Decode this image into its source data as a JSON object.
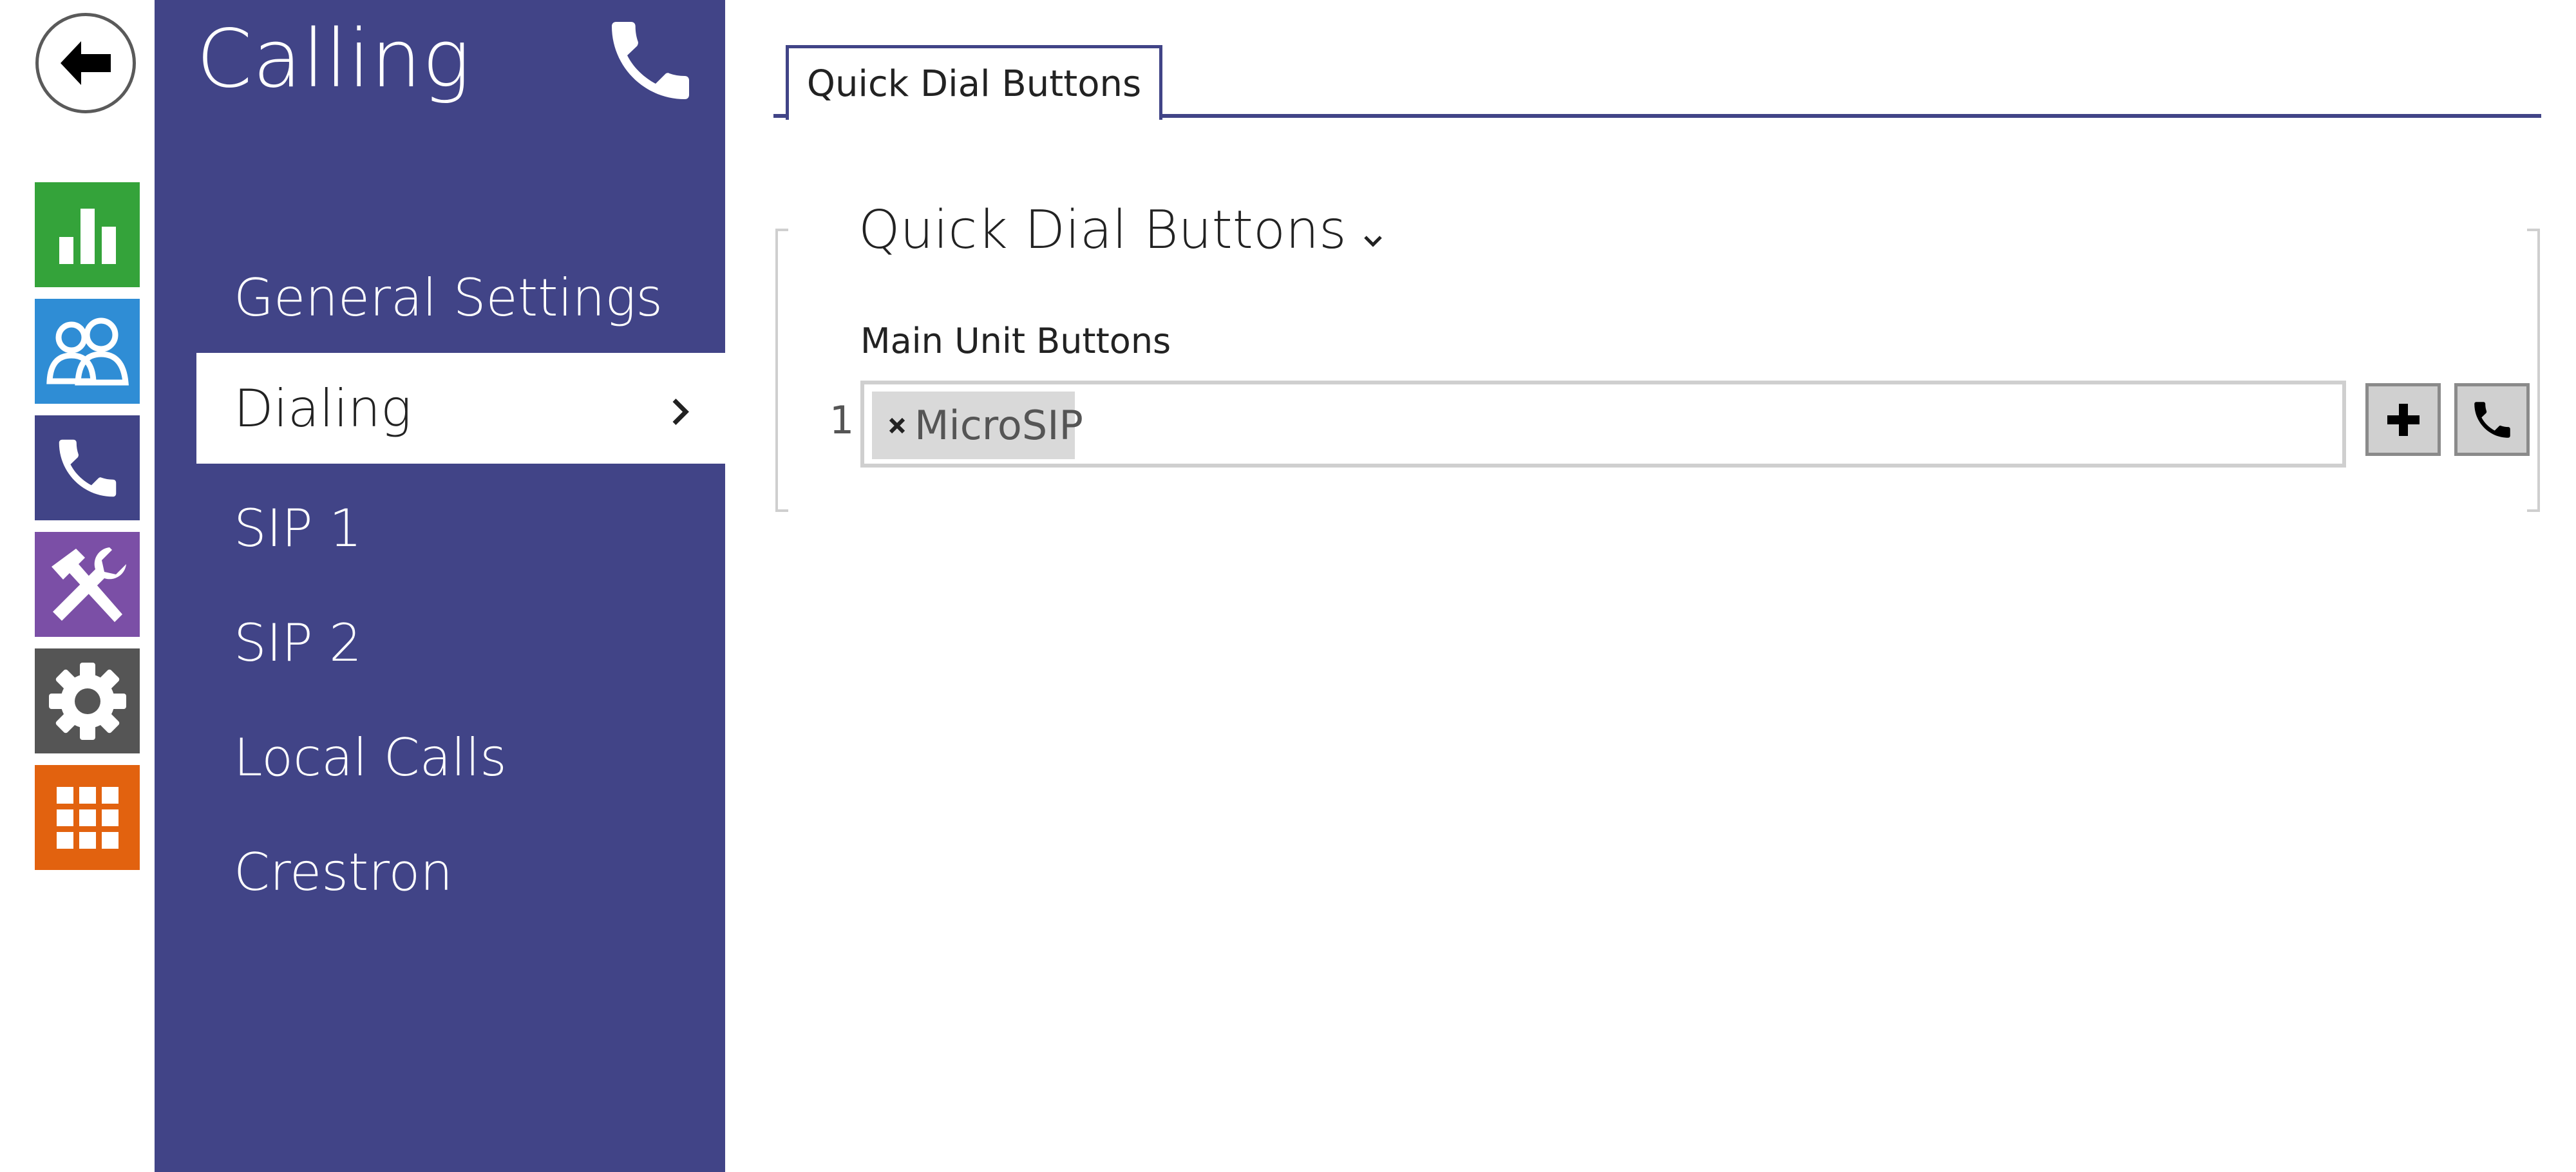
{
  "rail": {
    "items": [
      {
        "name": "Status",
        "icon": "bar-chart-icon",
        "color": "#34a33a"
      },
      {
        "name": "Directory",
        "icon": "users-icon",
        "color": "#2f8dd5"
      },
      {
        "name": "Calling",
        "icon": "phone-icon",
        "color": "#414487"
      },
      {
        "name": "Hardware",
        "icon": "tools-icon",
        "color": "#7b4fa6"
      },
      {
        "name": "System",
        "icon": "gear-icon",
        "color": "#555555"
      },
      {
        "name": "Services",
        "icon": "grid-icon",
        "color": "#e2620f"
      }
    ]
  },
  "nav": {
    "title": "Calling",
    "items": [
      {
        "label": "General Settings"
      },
      {
        "label": "Dialing"
      },
      {
        "label": "SIP 1"
      },
      {
        "label": "SIP 2"
      },
      {
        "label": "Local Calls"
      },
      {
        "label": "Crestron"
      }
    ],
    "active_index": 1
  },
  "main": {
    "tab_label": "Quick Dial Buttons",
    "section_title": "Quick Dial Buttons",
    "field_label": "Main Unit Buttons",
    "row_index": "1",
    "tags": [
      "MicroSIP"
    ]
  },
  "colors": {
    "accent": "#414487",
    "border": "#cfcfcf"
  }
}
